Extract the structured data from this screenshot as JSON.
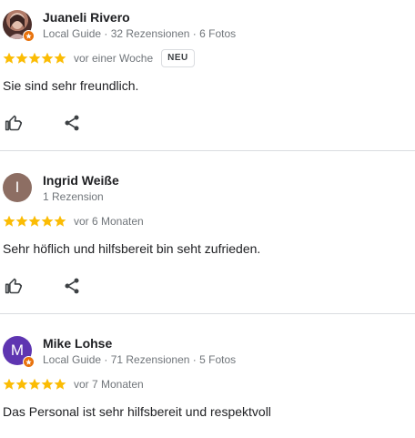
{
  "reviews": [
    {
      "name": "Juaneli Rivero",
      "meta": "Local Guide · 32 Rezensionen · 6 Fotos",
      "rating": 5,
      "time": "vor einer Woche",
      "badge": "NEU",
      "text": "Sie sind sehr freundlich.",
      "avatar_type": "photo",
      "avatar_letter": "",
      "avatar_color": "#8d6e63",
      "local_guide": true
    },
    {
      "name": "Ingrid Weiße",
      "meta": "1 Rezension",
      "rating": 5,
      "time": "vor 6 Monaten",
      "badge": "",
      "text": "Sehr höflich und hilfsbereit bin seht zufrieden.",
      "avatar_type": "letter",
      "avatar_letter": "I",
      "avatar_color": "#8d6e63",
      "local_guide": false
    },
    {
      "name": "Mike Lohse",
      "meta": "Local Guide · 71 Rezensionen · 5 Fotos",
      "rating": 5,
      "time": "vor 7 Monaten",
      "badge": "",
      "text": "Das Personal ist sehr hilfsbereit und respektvoll",
      "avatar_type": "letter",
      "avatar_letter": "M",
      "avatar_color": "#5e35b1",
      "local_guide": true
    }
  ],
  "icons": {
    "like": "thumb-up-icon",
    "share": "share-icon",
    "star": "star-icon",
    "guide": "local-guide-badge-icon"
  },
  "colors": {
    "star": "#fbbc04",
    "guide_badge": "#e8710a",
    "meta_text": "#70757a",
    "divider": "#dadce0"
  }
}
